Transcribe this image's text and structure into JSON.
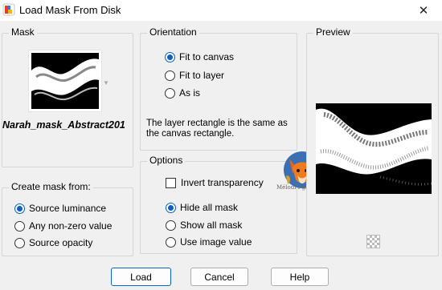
{
  "window": {
    "title": "Load Mask From Disk",
    "close_glyph": "✕"
  },
  "mask": {
    "group_label": "Mask",
    "name": "Narah_mask_Abstract201"
  },
  "create_from": {
    "group_label": "Create mask from:",
    "options": [
      {
        "label": "Source luminance",
        "checked": true
      },
      {
        "label": "Any non-zero value",
        "checked": false
      },
      {
        "label": "Source opacity",
        "checked": false
      }
    ]
  },
  "orientation": {
    "group_label": "Orientation",
    "options": [
      {
        "label": "Fit to canvas",
        "checked": true
      },
      {
        "label": "Fit to layer",
        "checked": false
      },
      {
        "label": "As is",
        "checked": false
      }
    ],
    "description": "The layer rectangle is the same as the canvas rectangle."
  },
  "options": {
    "group_label": "Options",
    "invert_label": "Invert transparency",
    "invert_checked": false,
    "radios": [
      {
        "label": "Hide all mask",
        "checked": true
      },
      {
        "label": "Show all mask",
        "checked": false
      },
      {
        "label": "Use image value",
        "checked": false
      }
    ]
  },
  "preview": {
    "group_label": "Preview"
  },
  "watermark_text": "Mélodi-l-graph",
  "buttons": {
    "load": "Load",
    "cancel": "Cancel",
    "help": "Help"
  },
  "colors": {
    "accent": "#0a5fbf",
    "background": "#f0f0f0"
  }
}
